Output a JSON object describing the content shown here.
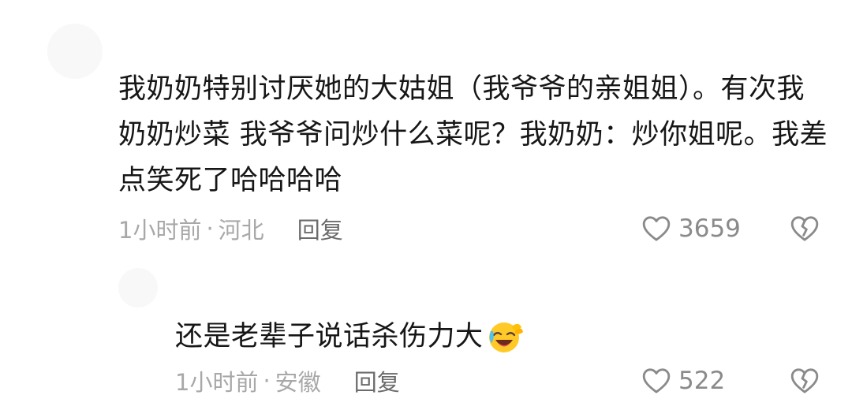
{
  "comments": [
    {
      "text": "我奶奶特别讨厌她的大姑姐（我爷爷的亲姐姐）。有次我奶奶炒菜 我爷爷问炒什么菜呢？我奶奶：炒你姐呢。我差点笑死了哈哈哈哈",
      "time": "1小时前",
      "separator": "·",
      "region": "河北",
      "reply_label": "回复",
      "like_count": "3659",
      "like_icon": "heart-outline-icon",
      "dislike_icon": "broken-heart-icon"
    },
    {
      "text": "还是老辈子说话杀伤力大",
      "emoji": "laughing-crying-emoji",
      "time": "1小时前",
      "separator": "·",
      "region": "安徽",
      "reply_label": "回复",
      "like_count": "522",
      "like_icon": "heart-outline-icon",
      "dislike_icon": "broken-heart-icon"
    }
  ],
  "colors": {
    "text": "#161616",
    "meta": "#a8a8a8",
    "reply": "#6b6b6b",
    "icon": "#8a8a8a"
  }
}
